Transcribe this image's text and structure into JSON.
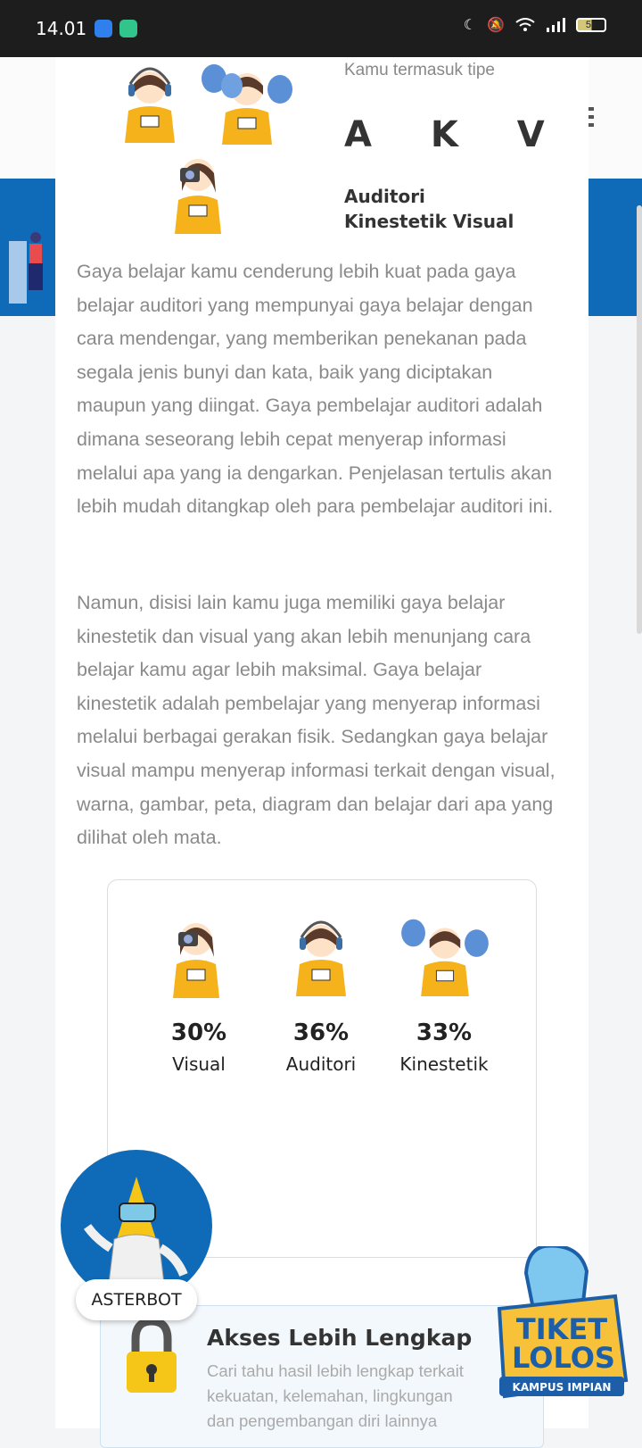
{
  "status_bar": {
    "time": "14.01",
    "battery_level": "51",
    "icons": [
      "moon-icon",
      "mute-icon",
      "wifi-icon",
      "signal-icon",
      "battery-icon"
    ]
  },
  "result": {
    "type_intro": "Kamu termasuk tipe",
    "code": "A K V",
    "name": "Auditori Kinestetik Visual"
  },
  "paragraphs": {
    "p1": "Gaya belajar kamu cenderung lebih kuat pada gaya belajar auditori yang mempunyai gaya belajar dengan cara mendengar, yang memberikan penekanan pada segala jenis bunyi dan kata, baik yang diciptakan maupun yang diingat. Gaya pembelajar auditori adalah dimana seseorang lebih cepat menyerap informasi melalui apa yang ia dengarkan. Penjelasan tertulis akan lebih mudah ditangkap oleh para pembelajar auditori ini.",
    "p2": "Namun, disisi lain kamu juga memiliki gaya belajar kinestetik dan visual yang akan lebih menunjang cara belajar kamu agar lebih maksimal. Gaya belajar kinestetik adalah pembelajar yang menyerap informasi melalui berbagai gerakan fisik. Sedangkan gaya belajar visual mampu menyerap informasi terkait dengan visual, warna, gambar, peta, diagram dan belajar dari apa yang dilihat oleh mata."
  },
  "stats": [
    {
      "percent": "30%",
      "label": "Visual"
    },
    {
      "percent": "36%",
      "label": "Auditori"
    },
    {
      "percent": "33%",
      "label": "Kinestetik"
    }
  ],
  "asterbot": {
    "label": "ASTERBOT"
  },
  "access": {
    "title": "Akses Lebih Lengkap",
    "text": "Cari tahu hasil lebih lengkap terkait kekuatan, kelemahan, lingkungan dan pengembangan diri lainnya"
  },
  "promo": {
    "line1": "TIKET",
    "line2": "LOLOS",
    "line3": "KAMPUS IMPIAN"
  },
  "colors": {
    "brand_blue": "#0f6bb8",
    "shirt_yellow": "#f5b21a"
  }
}
